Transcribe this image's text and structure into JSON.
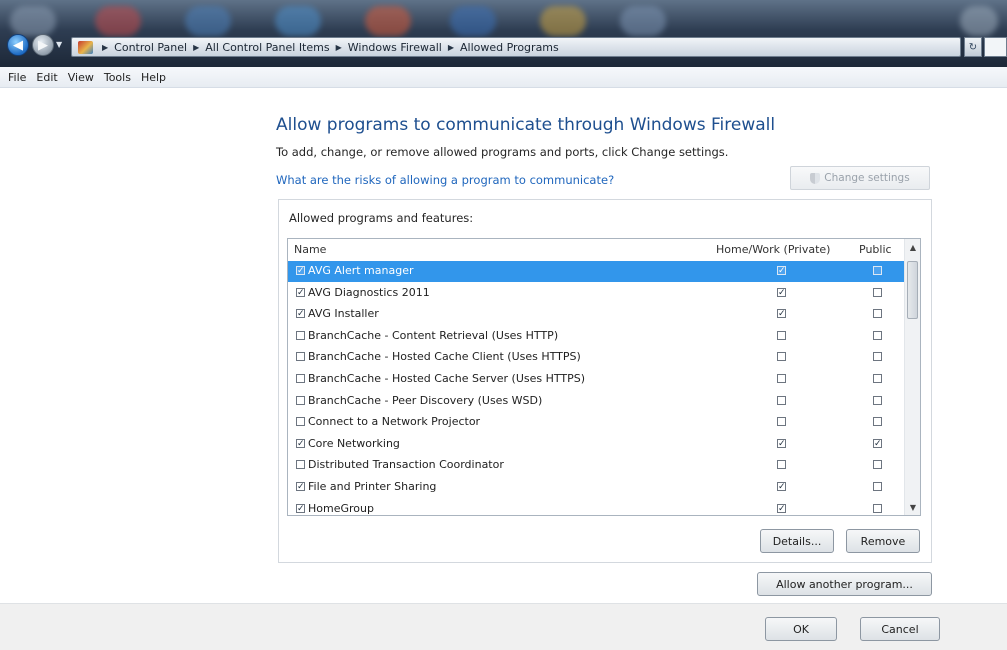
{
  "window": {
    "breadcrumb": [
      "Control Panel",
      "All Control Panel Items",
      "Windows Firewall",
      "Allowed Programs"
    ],
    "icons": {
      "back": "back-arrow-icon",
      "forward": "forward-arrow-icon",
      "control_panel": "control-panel-icon",
      "refresh": "refresh-icon"
    }
  },
  "menu": [
    "File",
    "Edit",
    "View",
    "Tools",
    "Help"
  ],
  "main": {
    "heading": "Allow programs to communicate through Windows Firewall",
    "description": "To add, change, or remove allowed programs and ports, click Change settings.",
    "risk_link": "What are the risks of allowing a program to communicate?",
    "change_settings": "Change settings",
    "group_title": "Allowed programs and features:",
    "columns": {
      "name": "Name",
      "home": "Home/Work (Private)",
      "public": "Public"
    },
    "programs": [
      {
        "name": "AVG Alert manager",
        "enabled": true,
        "home": true,
        "public": false,
        "selected": true
      },
      {
        "name": "AVG Diagnostics 2011",
        "enabled": true,
        "home": true,
        "public": false
      },
      {
        "name": "AVG Installer",
        "enabled": true,
        "home": true,
        "public": false
      },
      {
        "name": "BranchCache - Content Retrieval (Uses HTTP)",
        "enabled": false,
        "home": false,
        "public": false
      },
      {
        "name": "BranchCache - Hosted Cache Client (Uses HTTPS)",
        "enabled": false,
        "home": false,
        "public": false
      },
      {
        "name": "BranchCache - Hosted Cache Server (Uses HTTPS)",
        "enabled": false,
        "home": false,
        "public": false
      },
      {
        "name": "BranchCache - Peer Discovery (Uses WSD)",
        "enabled": false,
        "home": false,
        "public": false
      },
      {
        "name": "Connect to a Network Projector",
        "enabled": false,
        "home": false,
        "public": false
      },
      {
        "name": "Core Networking",
        "enabled": true,
        "home": true,
        "public": true
      },
      {
        "name": "Distributed Transaction Coordinator",
        "enabled": false,
        "home": false,
        "public": false
      },
      {
        "name": "File and Printer Sharing",
        "enabled": true,
        "home": true,
        "public": false
      },
      {
        "name": "HomeGroup",
        "enabled": true,
        "home": true,
        "public": false
      }
    ],
    "details_button": "Details...",
    "remove_button": "Remove",
    "allow_another_button": "Allow another program..."
  },
  "footer": {
    "ok": "OK",
    "cancel": "Cancel"
  }
}
